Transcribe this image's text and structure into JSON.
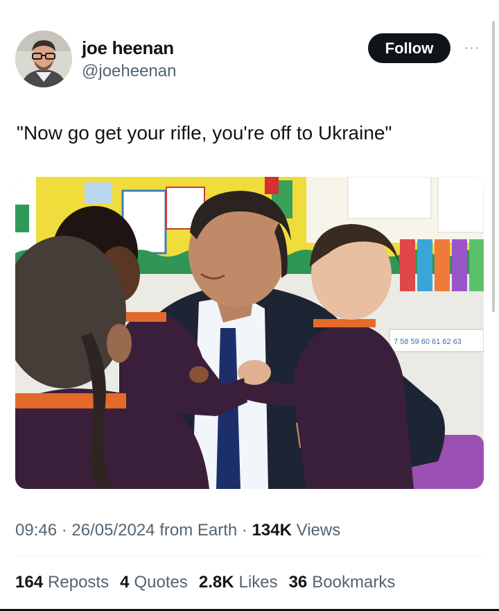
{
  "author": {
    "name": "joe heenan",
    "handle": "@joeheenan"
  },
  "header": {
    "follow_label": "Follow",
    "more_label": "···"
  },
  "tweet": {
    "text": "\"Now go get your rifle, you're off to Ukraine\""
  },
  "meta": {
    "time": "09:46",
    "date": "26/05/2024",
    "source": "from Earth",
    "views_count": "134K",
    "views_label": "Views"
  },
  "stats": {
    "reposts_count": "164",
    "reposts_label": "Reposts",
    "quotes_count": "4",
    "quotes_label": "Quotes",
    "likes_count": "2.8K",
    "likes_label": "Likes",
    "bookmarks_count": "36",
    "bookmarks_label": "Bookmarks"
  },
  "media": {
    "numberline": "7 58 59 60 61 62 63"
  },
  "colors": {
    "text": "#0f1419",
    "secondary": "#536471",
    "button": "#0f1419"
  }
}
